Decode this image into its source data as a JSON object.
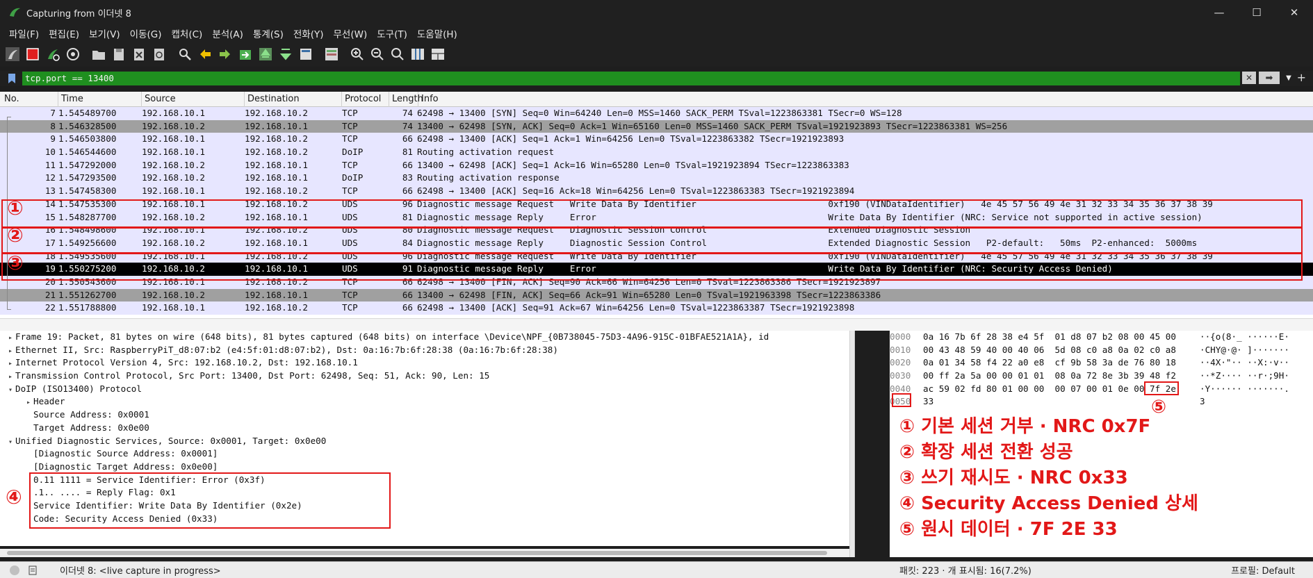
{
  "window": {
    "title": "Capturing from 이더넷 8",
    "minimize": "—",
    "maximize": "☐",
    "close": "✕"
  },
  "menu": [
    "파일(F)",
    "편집(E)",
    "보기(V)",
    "이동(G)",
    "캡처(C)",
    "분석(A)",
    "통계(S)",
    "전화(Y)",
    "무선(W)",
    "도구(T)",
    "도움말(H)"
  ],
  "filter": {
    "value": "tcp.port == 13400",
    "accent": "#1f8f1f"
  },
  "packet_list": {
    "columns": [
      "No.",
      "Time",
      "Source",
      "Destination",
      "Protocol",
      "Length",
      "Info"
    ],
    "rows": [
      {
        "no": "7",
        "time": "1.545489700",
        "src": "192.168.10.1",
        "dst": "192.168.10.2",
        "proto": "TCP",
        "len": "74",
        "info": "62498 → 13400 [SYN] Seq=0 Win=64240 Len=0 MSS=1460 SACK_PERM TSval=1223863381 TSecr=0 WS=128"
      },
      {
        "no": "8",
        "time": "1.546328500",
        "src": "192.168.10.2",
        "dst": "192.168.10.1",
        "proto": "TCP",
        "len": "74",
        "info": "13400 → 62498 [SYN, ACK] Seq=0 Ack=1 Win=65160 Len=0 MSS=1460 SACK_PERM TSval=1921923893 TSecr=1223863381 WS=256"
      },
      {
        "no": "9",
        "time": "1.546503800",
        "src": "192.168.10.1",
        "dst": "192.168.10.2",
        "proto": "TCP",
        "len": "66",
        "info": "62498 → 13400 [ACK] Seq=1 Ack=1 Win=64256 Len=0 TSval=1223863382 TSecr=1921923893"
      },
      {
        "no": "10",
        "time": "1.546544600",
        "src": "192.168.10.1",
        "dst": "192.168.10.2",
        "proto": "DoIP",
        "len": "81",
        "info": "Routing activation request"
      },
      {
        "no": "11",
        "time": "1.547292000",
        "src": "192.168.10.2",
        "dst": "192.168.10.1",
        "proto": "TCP",
        "len": "66",
        "info": "13400 → 62498 [ACK] Seq=1 Ack=16 Win=65280 Len=0 TSval=1921923894 TSecr=1223863383"
      },
      {
        "no": "12",
        "time": "1.547293500",
        "src": "192.168.10.2",
        "dst": "192.168.10.1",
        "proto": "DoIP",
        "len": "83",
        "info": "Routing activation response"
      },
      {
        "no": "13",
        "time": "1.547458300",
        "src": "192.168.10.1",
        "dst": "192.168.10.2",
        "proto": "TCP",
        "len": "66",
        "info": "62498 → 13400 [ACK] Seq=16 Ack=18 Win=64256 Len=0 TSval=1223863383 TSecr=1921923894"
      },
      {
        "no": "14",
        "time": "1.547535300",
        "src": "192.168.10.1",
        "dst": "192.168.10.2",
        "proto": "UDS",
        "len": "96",
        "info": "Diagnostic message Request   Write Data By Identifier                         0xf190 (VINDataIdentifier)   4e 45 57 56 49 4e 31 32 33 34 35 36 37 38 39"
      },
      {
        "no": "15",
        "time": "1.548287700",
        "src": "192.168.10.2",
        "dst": "192.168.10.1",
        "proto": "UDS",
        "len": "81",
        "info": "Diagnostic message Reply     Error                                            Write Data By Identifier (NRC: Service not supported in active session)"
      },
      {
        "no": "16",
        "time": "1.548498600",
        "src": "192.168.10.1",
        "dst": "192.168.10.2",
        "proto": "UDS",
        "len": "80",
        "info": "Diagnostic message Request   Diagnostic Session Control                       Extended Diagnostic Session"
      },
      {
        "no": "17",
        "time": "1.549256600",
        "src": "192.168.10.2",
        "dst": "192.168.10.1",
        "proto": "UDS",
        "len": "84",
        "info": "Diagnostic message Reply     Diagnostic Session Control                       Extended Diagnostic Session   P2-default:   50ms  P2-enhanced:  5000ms"
      },
      {
        "no": "18",
        "time": "1.549535600",
        "src": "192.168.10.1",
        "dst": "192.168.10.2",
        "proto": "UDS",
        "len": "96",
        "info": "Diagnostic message Request   Write Data By Identifier                         0xf190 (VINDataIdentifier)   4e 45 57 56 49 4e 31 32 33 34 35 36 37 38 39"
      },
      {
        "no": "19",
        "time": "1.550275200",
        "src": "192.168.10.2",
        "dst": "192.168.10.1",
        "proto": "UDS",
        "len": "91",
        "info": "Diagnostic message Reply     Error                                            Write Data By Identifier (NRC: Security Access Denied)"
      },
      {
        "no": "20",
        "time": "1.550543600",
        "src": "192.168.10.1",
        "dst": "192.168.10.2",
        "proto": "TCP",
        "len": "66",
        "info": "62498 → 13400 [FIN, ACK] Seq=90 Ack=66 Win=64256 Len=0 TSval=1223863386 TSecr=1921923897"
      },
      {
        "no": "21",
        "time": "1.551262700",
        "src": "192.168.10.2",
        "dst": "192.168.10.1",
        "proto": "TCP",
        "len": "66",
        "info": "13400 → 62498 [FIN, ACK] Seq=66 Ack=91 Win=65280 Len=0 TSval=1921963398 TSecr=1223863386"
      },
      {
        "no": "22",
        "time": "1.551788800",
        "src": "192.168.10.1",
        "dst": "192.168.10.2",
        "proto": "TCP",
        "len": "66",
        "info": "62498 → 13400 [ACK] Seq=91 Ack=67 Win=64256 Len=0 TSval=1223863387 TSecr=1921923898"
      }
    ]
  },
  "annotations": {
    "markers": [
      "①",
      "②",
      "③",
      "④",
      "⑤"
    ],
    "color": "#e21818"
  },
  "details": [
    {
      "indent": 0,
      "arrow": "▸",
      "text": "Frame 19: Packet, 81 bytes on wire (648 bits), 81 bytes captured (648 bits) on interface \\Device\\NPF_{0B738045-75D3-4A96-915C-01BFAE521A1A}, id"
    },
    {
      "indent": 0,
      "arrow": "▸",
      "text": "Ethernet II, Src: RaspberryPiT_d8:07:b2 (e4:5f:01:d8:07:b2), Dst: 0a:16:7b:6f:28:38 (0a:16:7b:6f:28:38)"
    },
    {
      "indent": 0,
      "arrow": "▸",
      "text": "Internet Protocol Version 4, Src: 192.168.10.2, Dst: 192.168.10.1"
    },
    {
      "indent": 0,
      "arrow": "▸",
      "text": "Transmission Control Protocol, Src Port: 13400, Dst Port: 62498, Seq: 51, Ack: 90, Len: 15"
    },
    {
      "indent": 0,
      "arrow": "▾",
      "text": "DoIP (ISO13400) Protocol"
    },
    {
      "indent": 1,
      "arrow": "▸",
      "text": "Header"
    },
    {
      "indent": 1,
      "arrow": "",
      "text": "Source Address: 0x0001"
    },
    {
      "indent": 1,
      "arrow": "",
      "text": "Target Address: 0x0e00"
    },
    {
      "indent": 0,
      "arrow": "▾",
      "text": "Unified Diagnostic Services, Source: 0x0001, Target: 0x0e00"
    },
    {
      "indent": 1,
      "arrow": "",
      "text": "[Diagnostic Source Address: 0x0001]"
    },
    {
      "indent": 1,
      "arrow": "",
      "text": "[Diagnostic Target Address: 0x0e00]"
    },
    {
      "indent": 1,
      "arrow": "",
      "text": "0.11 1111 = Service Identifier: Error (0x3f)"
    },
    {
      "indent": 1,
      "arrow": "",
      "text": ".1.. .... = Reply Flag: 0x1"
    },
    {
      "indent": 1,
      "arrow": "",
      "text": "Service Identifier: Write Data By Identifier (0x2e)"
    },
    {
      "indent": 1,
      "arrow": "",
      "text": "Code: Security Access Denied (0x33)"
    }
  ],
  "bytes": [
    {
      "off": "0000",
      "hex": "0a 16 7b 6f 28 38 e4 5f  01 d8 07 b2 08 00 45 00",
      "asc": "··{o(8·_ ······E·"
    },
    {
      "off": "0010",
      "hex": "00 43 48 59 40 00 40 06  5d 08 c0 a8 0a 02 c0 a8",
      "asc": "·CHY@·@· ]·······"
    },
    {
      "off": "0020",
      "hex": "0a 01 34 58 f4 22 a0 e8  cf 9b 58 3a de 76 80 18",
      "asc": "··4X·\"·· ··X:·v··"
    },
    {
      "off": "0030",
      "hex": "00 ff 2a 5a 00 00 01 01  08 0a 72 8e 3b 39 48 f2",
      "asc": "··*Z···· ··r·;9H·"
    },
    {
      "off": "0040",
      "hex": "ac 59 02 fd 80 01 00 00  00 07 00 01 0e 00 7f 2e",
      "asc": "·Y······ ·······."
    },
    {
      "off": "0050",
      "hex": "33",
      "asc": "3"
    }
  ],
  "legend": [
    "① 기본 세션 거부 · NRC 0x7F",
    "② 확장 세션 전환 성공",
    "③ 쓰기 재시도 · NRC 0x33",
    "④ Security Access Denied 상세",
    "⑤ 원시 데이터 · 7F 2E 33"
  ],
  "status": {
    "capture": "이더넷 8: <live capture in progress>",
    "packets": "패킷: 223 · 개 표시됨: 16(7.2%)",
    "profile": "프로필: Default"
  }
}
